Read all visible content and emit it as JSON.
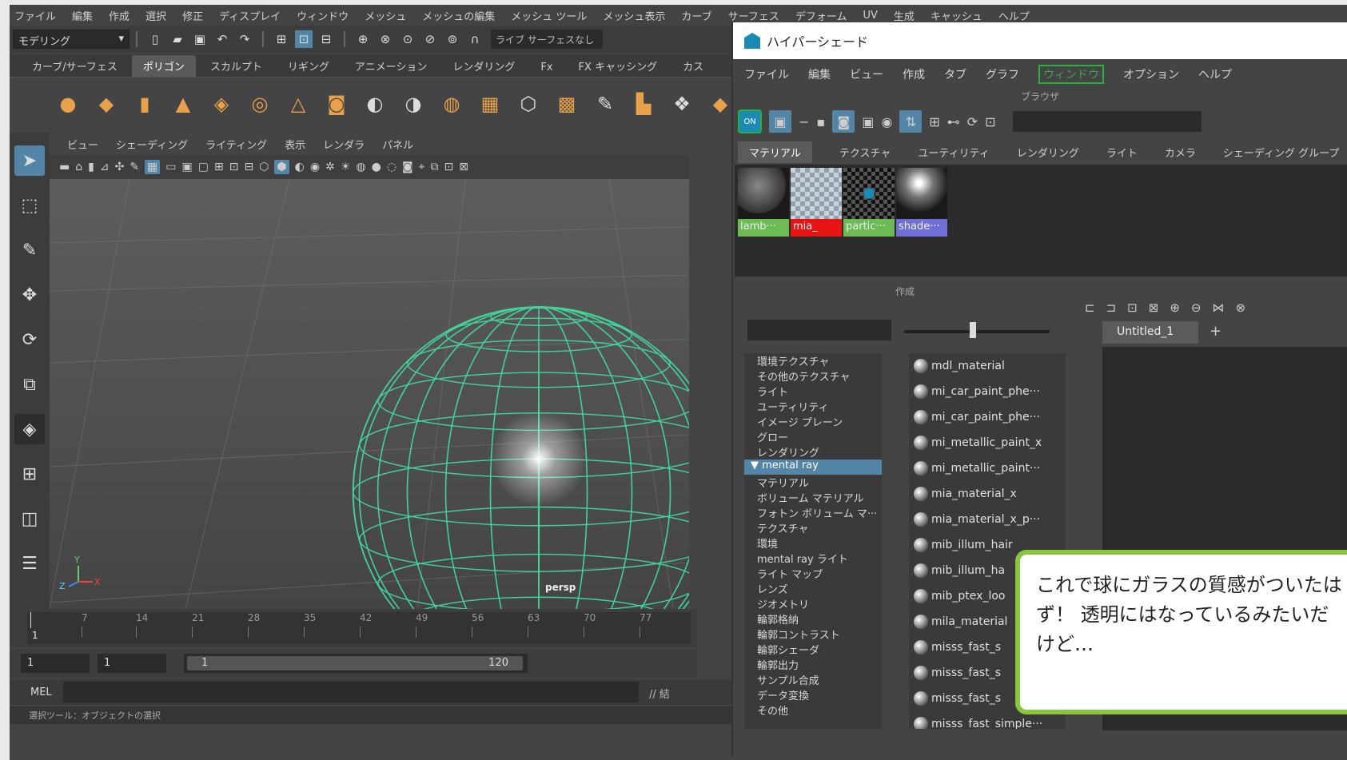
{
  "main_menu": [
    "ファイル",
    "編集",
    "作成",
    "選択",
    "修正",
    "ディスプレイ",
    "ウィンドウ",
    "メッシュ",
    "メッシュの編集",
    "メッシュ ツール",
    "メッシュ表示",
    "カーブ",
    "サーフェス",
    "デフォーム",
    "UV",
    "生成",
    "キャッシュ",
    "ヘルプ"
  ],
  "status_line": {
    "mode": "モデリング",
    "live_surface": "ライブ サーフェスなし"
  },
  "shelf_tabs": [
    "カーブ/サーフェス",
    "ポリゴン",
    "スカルプト",
    "リギング",
    "アニメーション",
    "レンダリング",
    "Fx",
    "FX キャッシング",
    "カス"
  ],
  "shelf_active_tab": "ポリゴン",
  "panel_menu": [
    "ビュー",
    "シェーディング",
    "ライティング",
    "表示",
    "レンダラ",
    "パネル"
  ],
  "viewport": {
    "camera": "persp",
    "axis_x": "X",
    "axis_y": "Y",
    "axis_z": "Z",
    "wire_color": "#43d39a"
  },
  "timeline": {
    "ticks": [
      "1",
      "7",
      "14",
      "21",
      "28",
      "35",
      "42",
      "49",
      "56",
      "63",
      "70",
      "77"
    ]
  },
  "range": {
    "start": "1",
    "anim_start": "1",
    "range_start": "1",
    "range_end": "120"
  },
  "mel": {
    "label": "MEL",
    "right": "// 結"
  },
  "help_line": "選択ツール：オブジェクトの選択",
  "hypershade": {
    "title": "ハイパーシェード",
    "menu": [
      "ファイル",
      "編集",
      "ビュー",
      "作成",
      "タブ",
      "グラフ",
      "ウィンドウ",
      "オプション",
      "ヘルプ"
    ],
    "menu_highlight": "ウィンドウ",
    "browser_label": "ブラウザ",
    "tabs": [
      "マテリアル",
      "テクスチャ",
      "ユーティリティ",
      "レンダリング",
      "ライト",
      "カメラ",
      "シェーディング グループ"
    ],
    "swatches": [
      {
        "label": "lamb···",
        "color": "#6cbb55"
      },
      {
        "label": "mia_",
        "color": "#e81414"
      },
      {
        "label": "partic···",
        "color": "#6cbb55"
      },
      {
        "label": "shade···",
        "color": "#6f6fd6"
      }
    ],
    "create_label": "作成",
    "tree": [
      "環境テクスチャ",
      "その他のテクスチャ",
      "ライト",
      "ユーティリティ",
      "イメージ プレーン",
      "グロー",
      "レンダリング",
      "mental ray",
      "マテリアル",
      "ボリューム マテリアル",
      "フォトン ボリューム マ···",
      "テクスチャ",
      "環境",
      "mental ray ライト",
      "ライト マップ",
      "レンズ",
      "ジオメトリ",
      "輪郭格納",
      "輪郭コントラスト",
      "輪郭シェーダ",
      "輪郭出力",
      "サンプル合成",
      "データ変換",
      "その他"
    ],
    "tree_selected": "mental ray",
    "nodes": [
      "mdl_material",
      "mi_car_paint_phe···",
      "mi_car_paint_phe···",
      "mi_metallic_paint_x",
      "mi_metallic_paint···",
      "mia_material_x",
      "mia_material_x_p···",
      "mib_illum_hair",
      "mib_illum_ha",
      "mib_ptex_loo",
      "mila_material",
      "misss_fast_s",
      "misss_fast_s",
      "misss_fast_s",
      "misss_fast_simple···"
    ],
    "graph_tab": "Untitled_1",
    "graph_add": "+"
  },
  "subtitle": "これで球にガラスの質感がついたはず！ 透明にはなっているみたいだけど…"
}
